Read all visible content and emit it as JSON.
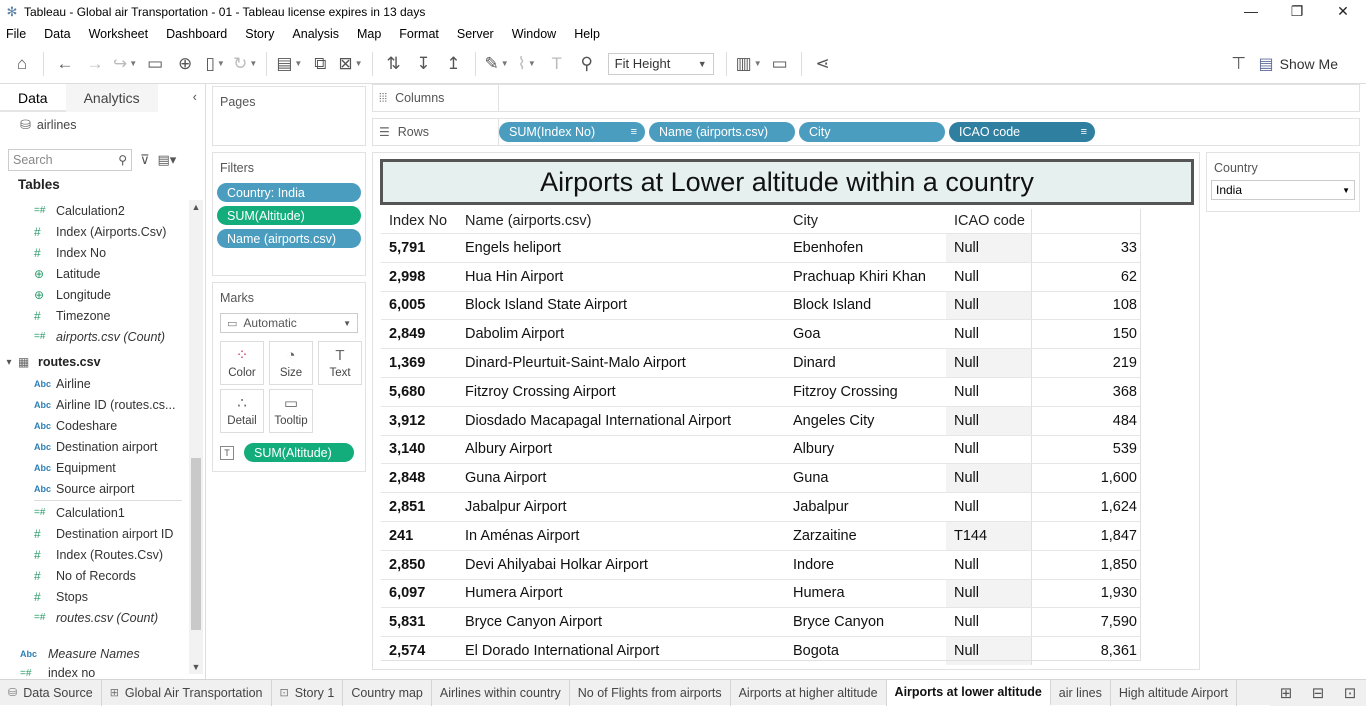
{
  "window": {
    "title": "Tableau - Global air Transportation  - 01 - Tableau license expires in 13 days",
    "minimize": "—",
    "restore": "❐",
    "close": "✕"
  },
  "menu": [
    "File",
    "Data",
    "Worksheet",
    "Dashboard",
    "Story",
    "Analysis",
    "Map",
    "Format",
    "Server",
    "Window",
    "Help"
  ],
  "toolbar": {
    "fit_label": "Fit Height",
    "show_me_label": "Show Me"
  },
  "data_pane": {
    "tab_data": "Data",
    "tab_analytics": "Analytics",
    "source_name": "airlines",
    "search_placeholder": "Search",
    "tables_header": "Tables",
    "airports_fields": [
      {
        "name": "Calculation2",
        "type": "calc"
      },
      {
        "name": "Index (Airports.Csv)",
        "type": "num"
      },
      {
        "name": "Index No",
        "type": "num"
      },
      {
        "name": "Latitude",
        "type": "geo"
      },
      {
        "name": "Longitude",
        "type": "geo"
      },
      {
        "name": "Timezone",
        "type": "num"
      },
      {
        "name": "airports.csv (Count)",
        "type": "calc",
        "italic": true
      }
    ],
    "routes_table": "routes.csv",
    "routes_dim_fields": [
      {
        "name": "Airline",
        "type": "str"
      },
      {
        "name": "Airline ID (routes.cs...",
        "type": "str"
      },
      {
        "name": "Codeshare",
        "type": "str"
      },
      {
        "name": "Destination airport",
        "type": "str"
      },
      {
        "name": "Equipment",
        "type": "str"
      },
      {
        "name": "Source airport",
        "type": "str"
      }
    ],
    "routes_measure_fields": [
      {
        "name": "Calculation1",
        "type": "calc"
      },
      {
        "name": "Destination airport ID",
        "type": "num"
      },
      {
        "name": "Index (Routes.Csv)",
        "type": "num"
      },
      {
        "name": "No of Records",
        "type": "num"
      },
      {
        "name": "Stops",
        "type": "num"
      },
      {
        "name": "routes.csv (Count)",
        "type": "calc",
        "italic": true
      }
    ],
    "measure_names": "Measure Names",
    "index_no_partial": "index no"
  },
  "pages_card": {
    "title": "Pages"
  },
  "filters_card": {
    "title": "Filters",
    "pills": [
      "Country: India",
      "SUM(Altitude)",
      "Name (airports.csv)"
    ]
  },
  "marks_card": {
    "title": "Marks",
    "type_label": "Automatic",
    "buttons": [
      "Color",
      "Size",
      "Text",
      "Detail",
      "Tooltip"
    ],
    "text_pill": "SUM(Altitude)"
  },
  "shelves": {
    "columns_label": "Columns",
    "rows_label": "Rows",
    "row_pills": [
      "SUM(Index No)",
      "Name (airports.csv)",
      "City",
      "ICAO code"
    ]
  },
  "viz": {
    "title": "Airports at Lower altitude within a country",
    "headers": [
      "Index No",
      "Name (airports.csv)",
      "City",
      "ICAO code"
    ],
    "rows": [
      {
        "index": "5,791",
        "name": "Engels heliport",
        "city": "Ebenhofen",
        "icao": "Null",
        "value": "33"
      },
      {
        "index": "2,998",
        "name": "Hua Hin Airport",
        "city": "Prachuap Khiri Khan",
        "icao": "Null",
        "value": "62"
      },
      {
        "index": "6,005",
        "name": "Block Island State Airport",
        "city": "Block Island",
        "icao": "Null",
        "value": "108"
      },
      {
        "index": "2,849",
        "name": "Dabolim Airport",
        "city": "Goa",
        "icao": "Null",
        "value": "150"
      },
      {
        "index": "1,369",
        "name": "Dinard-Pleurtuit-Saint-Malo Airport",
        "city": "Dinard",
        "icao": "Null",
        "value": "219"
      },
      {
        "index": "5,680",
        "name": "Fitzroy Crossing Airport",
        "city": "Fitzroy Crossing",
        "icao": "Null",
        "value": "368"
      },
      {
        "index": "3,912",
        "name": "Diosdado Macapagal International Airport",
        "city": "Angeles City",
        "icao": "Null",
        "value": "484"
      },
      {
        "index": "3,140",
        "name": "Albury Airport",
        "city": "Albury",
        "icao": "Null",
        "value": "539"
      },
      {
        "index": "2,848",
        "name": "Guna Airport",
        "city": "Guna",
        "icao": "Null",
        "value": "1,600"
      },
      {
        "index": "2,851",
        "name": "Jabalpur Airport",
        "city": "Jabalpur",
        "icao": "Null",
        "value": "1,624"
      },
      {
        "index": "241",
        "name": "In Aménas Airport",
        "city": "Zarzaitine",
        "icao": "T144",
        "value": "1,847"
      },
      {
        "index": "2,850",
        "name": "Devi Ahilyabai Holkar Airport",
        "city": "Indore",
        "icao": "Null",
        "value": "1,850"
      },
      {
        "index": "6,097",
        "name": "Humera Airport",
        "city": "Humera",
        "icao": "Null",
        "value": "1,930"
      },
      {
        "index": "5,831",
        "name": "Bryce Canyon Airport",
        "city": "Bryce Canyon",
        "icao": "Null",
        "value": "7,590"
      },
      {
        "index": "2,574",
        "name": "El Dorado International Airport",
        "city": "Bogota",
        "icao": "Null",
        "value": "8,361"
      }
    ]
  },
  "country_filter": {
    "title": "Country",
    "selected": "India"
  },
  "sheet_tabs": [
    {
      "label": "Data Source",
      "icon": "datasource-icon",
      "active": false
    },
    {
      "label": "Global Air Transportation",
      "icon": "dashboard-icon",
      "active": false
    },
    {
      "label": "Story 1",
      "icon": "story-icon",
      "active": false
    },
    {
      "label": "Country map",
      "active": false
    },
    {
      "label": "Airlines within country",
      "active": false
    },
    {
      "label": "No of Flights from airports",
      "active": false
    },
    {
      "label": "Airports at higher altitude",
      "active": false
    },
    {
      "label": "Airports at lower altitude",
      "active": true
    },
    {
      "label": "air lines",
      "active": false
    },
    {
      "label": "High altitude Airport",
      "active": false
    }
  ]
}
